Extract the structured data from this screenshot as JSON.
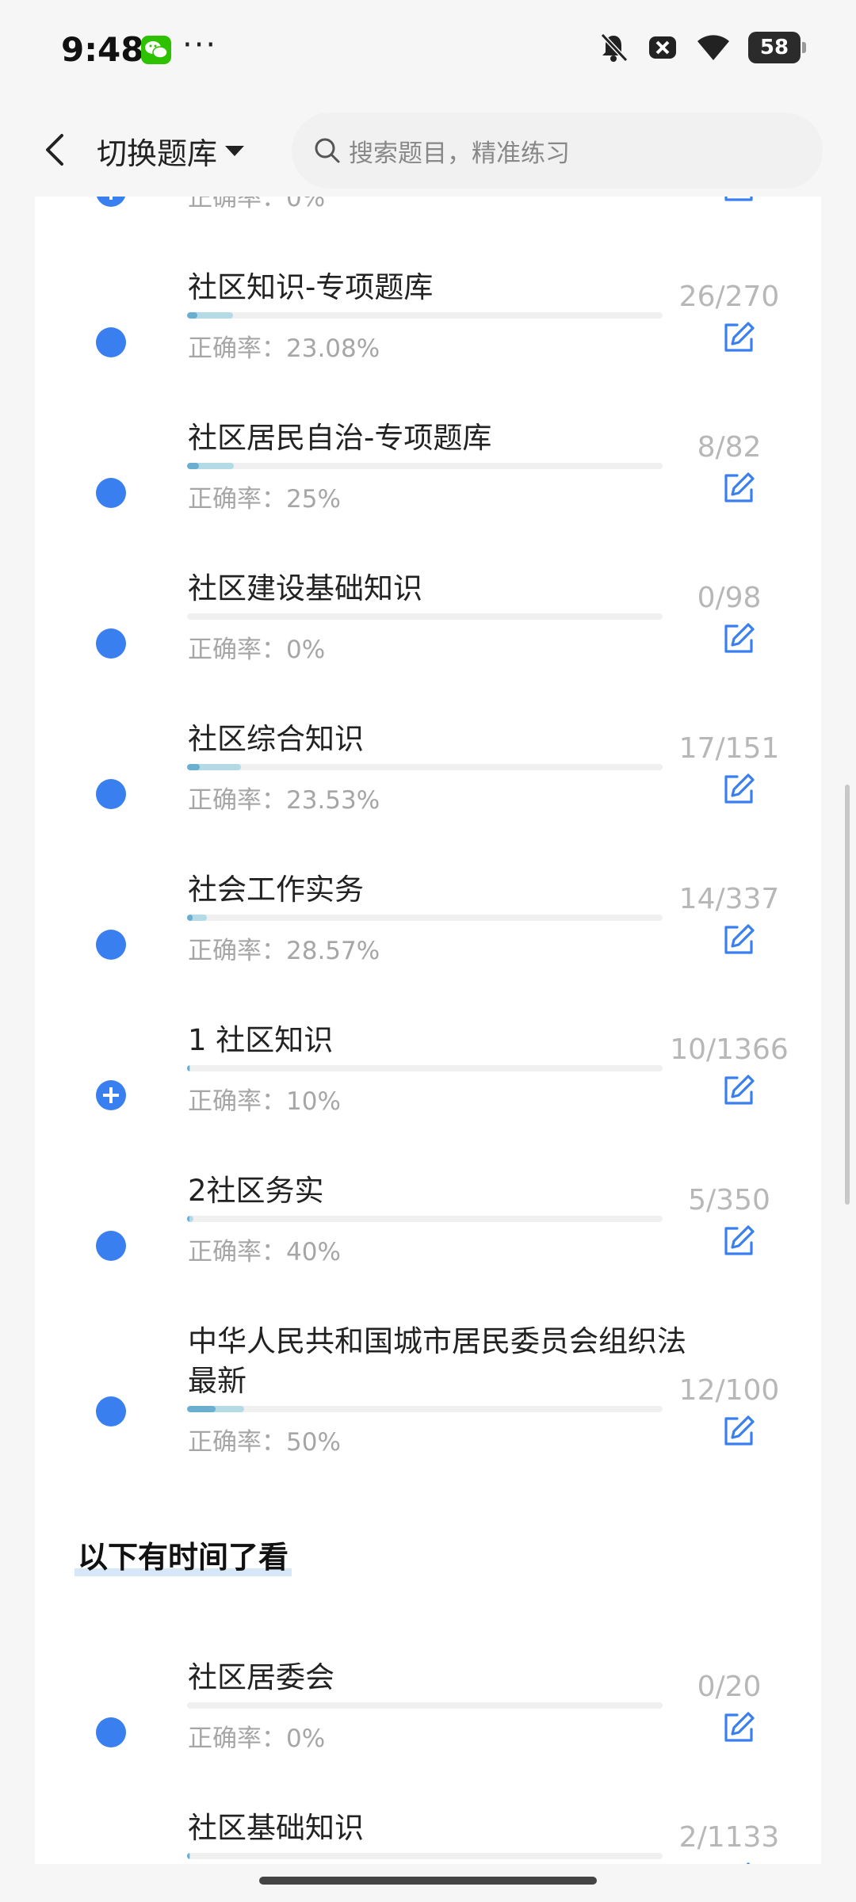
{
  "status_bar": {
    "time": "9:48",
    "more": "···",
    "battery": "58"
  },
  "header": {
    "title": "切换题库",
    "search_placeholder": "搜索题目，精准练习"
  },
  "rate_prefix": "正确率：",
  "items": [
    {
      "title": "",
      "rate": "0%",
      "count": "",
      "progress": 0,
      "icon": "plus"
    },
    {
      "title": "社区知识-专项题库",
      "rate": "23.08%",
      "count": "26/270",
      "progress": 0.096,
      "icon": "dot"
    },
    {
      "title": "社区居民自治-专项题库",
      "rate": "25%",
      "count": "8/82",
      "progress": 0.098,
      "icon": "dot"
    },
    {
      "title": "社区建设基础知识",
      "rate": "0%",
      "count": "0/98",
      "progress": 0,
      "icon": "dot"
    },
    {
      "title": "社区综合知识",
      "rate": "23.53%",
      "count": "17/151",
      "progress": 0.113,
      "icon": "dot"
    },
    {
      "title": "社会工作实务",
      "rate": "28.57%",
      "count": "14/337",
      "progress": 0.042,
      "icon": "dot"
    },
    {
      "title": "1 社区知识",
      "rate": "10%",
      "count": "10/1366",
      "progress": 0.007,
      "icon": "plus"
    },
    {
      "title": "2社区务实",
      "rate": "40%",
      "count": "5/350",
      "progress": 0.014,
      "icon": "dot"
    },
    {
      "title": "中华人民共和国城市居民委员会组织法 最新",
      "rate": "50%",
      "count": "12/100",
      "progress": 0.12,
      "icon": "dot"
    }
  ],
  "section": {
    "title": "以下有时间了看"
  },
  "section_items": [
    {
      "title": "社区居委会",
      "rate": "0%",
      "count": "0/20",
      "progress": 0,
      "icon": "dot"
    },
    {
      "title": "社区基础知识",
      "rate": "",
      "count": "2/1133",
      "progress": 0.002,
      "icon": "dot"
    }
  ],
  "colors": {
    "accent": "#3a7ff0",
    "progress_light": "#b4dbe5",
    "progress_dark": "#6aaed0"
  }
}
